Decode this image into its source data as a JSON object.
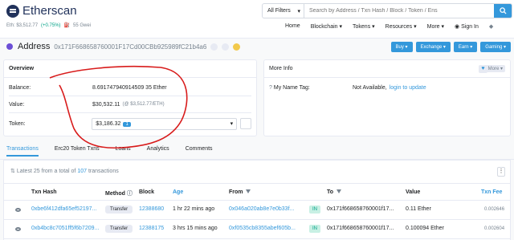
{
  "header": {
    "logo_text": "Etherscan",
    "eth_price": "Eth: $3,512.77",
    "eth_change": "(+0.75%)",
    "gas": "55 Gwei",
    "filter_label": "All Filters",
    "search_placeholder": "Search by Address / Txn Hash / Block / Token / Ens",
    "nav": [
      "Home",
      "Blockchain",
      "Tokens",
      "Resources",
      "More",
      "Sign In"
    ]
  },
  "address": {
    "title": "Address",
    "hash": "0x171F668658760001F17Cd00CBb925989fC21b4a6",
    "actions": [
      "Buy",
      "Exchange",
      "Earn",
      "Gaming"
    ]
  },
  "overview": {
    "heading": "Overview",
    "balance_label": "Balance:",
    "balance_value": "8.691747940914509 35 Ether",
    "value_label": "Value:",
    "value_amount": "$30,532.11",
    "value_sub": "(@ $3,512.77/ETH)",
    "token_label": "Token:",
    "token_value": "$3,186.32",
    "token_count": "1"
  },
  "moreinfo": {
    "heading": "More Info",
    "more_label": "More",
    "name_tag_label": "My Name Tag:",
    "name_tag_value": "Not Available,",
    "name_tag_link": "login to update"
  },
  "tabs": [
    "Transactions",
    "Erc20 Token Txns",
    "Loans",
    "Analytics",
    "Comments"
  ],
  "transactions": {
    "summary_prefix": "Latest 25 from a total of",
    "summary_count": "107",
    "summary_suffix": "transactions",
    "columns": [
      "Txn Hash",
      "Method",
      "Block",
      "Age",
      "From",
      "To",
      "Value",
      "Txn Fee"
    ],
    "rows": [
      {
        "hash": "0xbe6f412dfa65ef52197...",
        "method": "Transfer",
        "block": "12388680",
        "age": "1 hr 22 mins ago",
        "from": "0x046a020ab8e7e0b33f...",
        "dir": "IN",
        "to": "0x171f668658760001f17...",
        "value": "0.11 Ether",
        "fee": "0.002646"
      },
      {
        "hash": "0xb4bc8c7051ff5f6b7209...",
        "method": "Transfer",
        "block": "12388175",
        "age": "3 hrs 15 mins ago",
        "from": "0xf0535cb8355abef605b...",
        "dir": "IN",
        "to": "0x171f668658760001f17...",
        "value": "0.100094 Ether",
        "fee": "0.002604"
      }
    ]
  }
}
